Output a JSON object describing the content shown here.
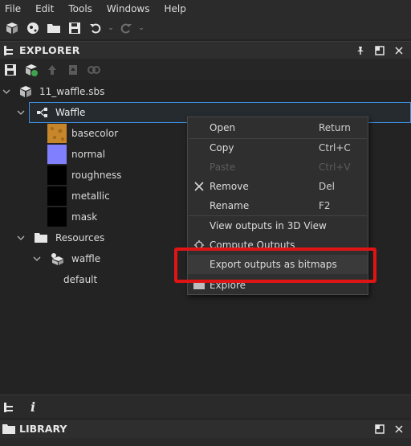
{
  "menu": {
    "file": "File",
    "edit": "Edit",
    "tools": "Tools",
    "windows": "Windows",
    "help": "Help"
  },
  "toolbar_icons": [
    "new-package-icon",
    "new-graph-icon",
    "open-folder-icon",
    "save-icon",
    "undo-icon",
    "redo-icon"
  ],
  "explorer": {
    "title": "EXPLORER",
    "header_icons": [
      "pin-icon",
      "maximize-icon",
      "close-icon"
    ],
    "tree": {
      "package": "11_waffle.sbs",
      "graph": "Waffle",
      "outputs": [
        {
          "label": "basecolor",
          "color": "#c8862a"
        },
        {
          "label": "normal",
          "color": "#8080ff"
        },
        {
          "label": "roughness",
          "color": "#000000"
        },
        {
          "label": "metallic",
          "color": "#000000"
        },
        {
          "label": "mask",
          "color": "#000000"
        }
      ],
      "resources_folder": "Resources",
      "resource": "waffle",
      "resource_child": "default"
    }
  },
  "context_menu": {
    "open": {
      "label": "Open",
      "shortcut": "Return"
    },
    "copy": {
      "label": "Copy",
      "shortcut": "Ctrl+C"
    },
    "paste": {
      "label": "Paste",
      "shortcut": "Ctrl+V"
    },
    "remove": {
      "label": "Remove",
      "shortcut": "Del"
    },
    "rename": {
      "label": "Rename",
      "shortcut": "F2"
    },
    "view3d": {
      "label": "View outputs in 3D View"
    },
    "compute": {
      "label": "Compute Outputs"
    },
    "export": {
      "label": "Export outputs as bitmaps"
    },
    "explore": {
      "label": "Explore"
    }
  },
  "highlight_color": "#e01414",
  "library": {
    "title": "LIBRARY"
  }
}
